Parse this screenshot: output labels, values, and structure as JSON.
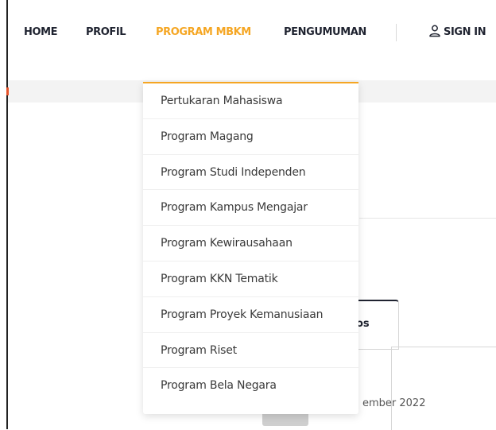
{
  "nav": {
    "items": [
      {
        "label": "HOME"
      },
      {
        "label": "PROFIL"
      },
      {
        "label": "PROGRAM MBKM"
      },
      {
        "label": "PENGUMUMAN"
      }
    ],
    "signin_label": "SIGN IN",
    "signin_icon": "user-icon",
    "active_color": "#f5a623"
  },
  "dropdown": {
    "items": [
      "Pertukaran Mahasiswa",
      "Program Magang",
      "Program Studi Independen",
      "Program Kampus Mengajar",
      "Program Kewirausahaan",
      "Program KKN Tematik",
      "Program Proyek Kemanusiaan",
      "Program Riset",
      "Program Bela Negara"
    ]
  },
  "background": {
    "tab_partial_text": "os",
    "date_partial_text": "ember 2022"
  }
}
